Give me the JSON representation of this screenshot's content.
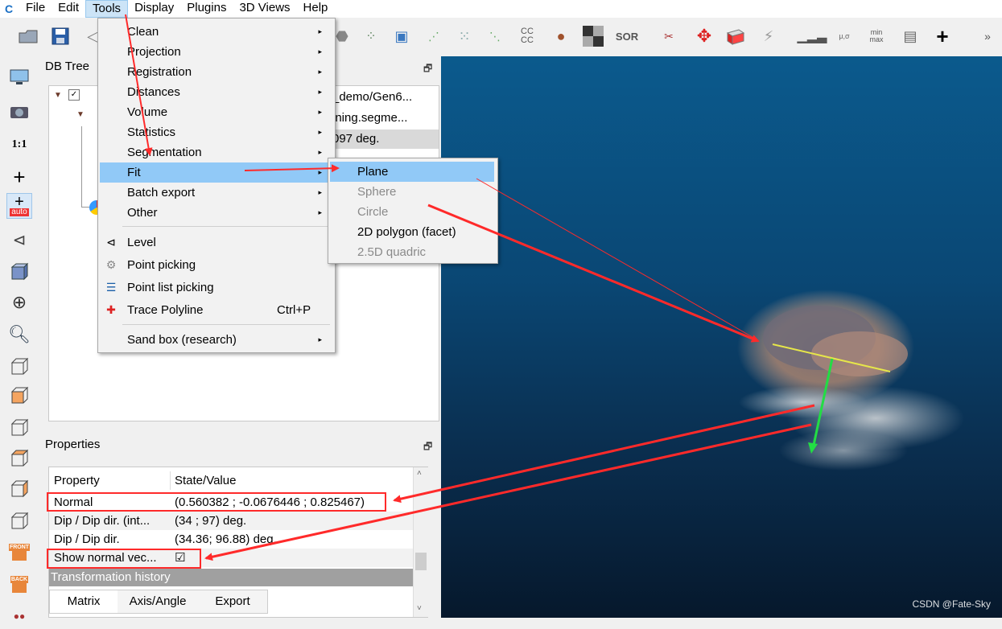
{
  "menubar": {
    "items": [
      "File",
      "Edit",
      "Tools",
      "Display",
      "Plugins",
      "3D Views",
      "Help"
    ]
  },
  "toolbar_text": {
    "cc_label": "CC CC",
    "sor_label": "SOR",
    "stats_label": "μ,σ",
    "minmax_label": "min max",
    "more_label": "»"
  },
  "left_toolbar": {
    "one_to_one": "1:1",
    "auto": "auto",
    "front": "FRONT",
    "back": "BACK"
  },
  "dbtree": {
    "title": "DB Tree",
    "rows": [
      "_demo/Gen6...",
      "ining.segme...",
      "097 deg."
    ]
  },
  "tools_menu": {
    "items": [
      {
        "label": "Clean",
        "submenu": true
      },
      {
        "label": "Projection",
        "submenu": true
      },
      {
        "label": "Registration",
        "submenu": true
      },
      {
        "label": "Distances",
        "submenu": true
      },
      {
        "label": "Volume",
        "submenu": true
      },
      {
        "label": "Statistics",
        "submenu": true
      },
      {
        "label": "Segmentation",
        "submenu": true
      },
      {
        "label": "Fit",
        "submenu": true,
        "highlighted": true
      },
      {
        "label": "Batch export",
        "submenu": true
      },
      {
        "label": "Other",
        "submenu": true
      },
      {
        "label": "Level",
        "icon": "level-icon"
      },
      {
        "label": "Point picking",
        "icon": "point-picking-icon"
      },
      {
        "label": "Point list picking",
        "icon": "point-list-icon"
      },
      {
        "label": "Trace Polyline",
        "icon": "polyline-icon",
        "shortcut": "Ctrl+P"
      },
      {
        "label": "Sand box (research)",
        "submenu": true
      }
    ]
  },
  "fit_submenu": {
    "items": [
      {
        "label": "Plane",
        "highlighted": true,
        "enabled": true
      },
      {
        "label": "Sphere",
        "enabled": false
      },
      {
        "label": "Circle",
        "enabled": false
      },
      {
        "label": "2D polygon (facet)",
        "enabled": true
      },
      {
        "label": "2.5D quadric",
        "enabled": false
      }
    ]
  },
  "properties": {
    "title": "Properties",
    "header": {
      "property": "Property",
      "value": "State/Value"
    },
    "rows": [
      {
        "property": "Normal",
        "value": "(0.560382 ; -0.0676446 ; 0.825467)"
      },
      {
        "property": "Dip / Dip dir. (int...",
        "value": "(34 ; 97) deg."
      },
      {
        "property": "Dip / Dip dir.",
        "value": "(34.36; 96.88) deg."
      },
      {
        "property": "Show normal vec...",
        "value": "☑"
      }
    ],
    "section": "Transformation history",
    "tabs": [
      "Matrix",
      "Axis/Angle",
      "Export"
    ]
  },
  "watermark": "CSDN @Fate-Sky",
  "colors": {
    "annotation_red": "#ff2a2a",
    "menu_highlight": "#91c9f7",
    "normal_arrow": "#22dd44",
    "plane_line": "#e6e64a"
  }
}
